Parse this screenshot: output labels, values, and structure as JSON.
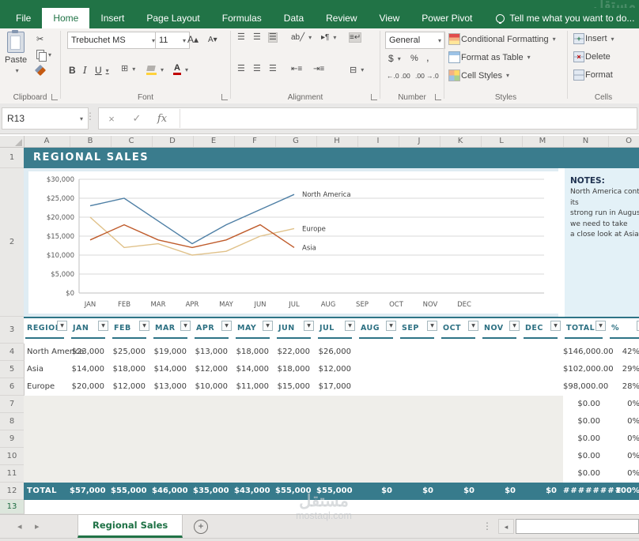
{
  "app": {
    "tell_me": "Tell me what you want to do...",
    "name_box": "R13",
    "formula_fx": "fx",
    "formula_value": ""
  },
  "ribbon": {
    "tabs": [
      "File",
      "Home",
      "Insert",
      "Page Layout",
      "Formulas",
      "Data",
      "Review",
      "View",
      "Power Pivot"
    ],
    "active_tab": "Home",
    "paste_label": "Paste",
    "font_name": "Trebuchet MS",
    "font_size": "11",
    "number_format": "General",
    "styles_buttons": [
      "Conditional Formatting",
      "Format as Table",
      "Cell Styles"
    ],
    "cells_buttons": [
      "Insert",
      "Delete",
      "Format"
    ],
    "group_labels": [
      "Clipboard",
      "Font",
      "Alignment",
      "Number",
      "Styles",
      "Cells"
    ]
  },
  "grid": {
    "columns": [
      "A",
      "B",
      "C",
      "D",
      "E",
      "F",
      "G",
      "H",
      "I",
      "J",
      "K",
      "L",
      "M",
      "N",
      "O"
    ],
    "rows": [
      "1",
      "2",
      "3",
      "4",
      "5",
      "6",
      "7",
      "8",
      "9",
      "10",
      "11",
      "12",
      "13"
    ],
    "selected_row": "13"
  },
  "sheet": {
    "title": "REGIONAL SALES",
    "notes_heading": "NOTES:",
    "notes_lines": [
      "North America continues",
      "its",
      "strong run in August, but",
      "we need to take",
      "a close look at Asia."
    ]
  },
  "chart_data": {
    "type": "line",
    "x": [
      "JAN",
      "FEB",
      "MAR",
      "APR",
      "MAY",
      "JUN",
      "JUL",
      "AUG",
      "SEP",
      "OCT",
      "NOV",
      "DEC"
    ],
    "series": [
      {
        "name": "North America",
        "color": "#4E7FA5",
        "values": [
          23000,
          25000,
          19000,
          13000,
          18000,
          22000,
          26000
        ]
      },
      {
        "name": "Europe",
        "color": "#E0C189",
        "values": [
          20000,
          12000,
          13000,
          10000,
          11000,
          15000,
          17000
        ]
      },
      {
        "name": "Asia",
        "color": "#BF5B2B",
        "values": [
          14000,
          18000,
          14000,
          12000,
          14000,
          18000,
          12000
        ]
      }
    ],
    "ylim": [
      0,
      30000
    ],
    "ytick_step": 5000,
    "ytick_labels": [
      "$0",
      "$5,000",
      "$10,000",
      "$15,000",
      "$20,000",
      "$25,000",
      "$30,000"
    ],
    "grid": true,
    "legend_position": "line-end"
  },
  "table": {
    "headers": [
      "REGION",
      "JAN",
      "FEB",
      "MAR",
      "APR",
      "MAY",
      "JUN",
      "JUL",
      "AUG",
      "SEP",
      "OCT",
      "NOV",
      "DEC",
      "TOTAL",
      "%"
    ],
    "rows": [
      {
        "region": "North America",
        "months": [
          "$23,000",
          "$25,000",
          "$19,000",
          "$13,000",
          "$18,000",
          "$22,000",
          "$26,000",
          "",
          "",
          "",
          "",
          ""
        ],
        "total": "$146,000.00",
        "pct": "42%"
      },
      {
        "region": "Asia",
        "months": [
          "$14,000",
          "$18,000",
          "$14,000",
          "$12,000",
          "$14,000",
          "$18,000",
          "$12,000",
          "",
          "",
          "",
          "",
          ""
        ],
        "total": "$102,000.00",
        "pct": "29%"
      },
      {
        "region": "Europe",
        "months": [
          "$20,000",
          "$12,000",
          "$13,000",
          "$10,000",
          "$11,000",
          "$15,000",
          "$17,000",
          "",
          "",
          "",
          "",
          ""
        ],
        "total": "$98,000.00",
        "pct": "28%"
      },
      {
        "region": "",
        "months": [
          "",
          "",
          "",
          "",
          "",
          "",
          "",
          "",
          "",
          "",
          "",
          ""
        ],
        "total": "$0.00",
        "pct": "0%"
      },
      {
        "region": "",
        "months": [
          "",
          "",
          "",
          "",
          "",
          "",
          "",
          "",
          "",
          "",
          "",
          ""
        ],
        "total": "$0.00",
        "pct": "0%"
      },
      {
        "region": "",
        "months": [
          "",
          "",
          "",
          "",
          "",
          "",
          "",
          "",
          "",
          "",
          "",
          ""
        ],
        "total": "$0.00",
        "pct": "0%"
      },
      {
        "region": "",
        "months": [
          "",
          "",
          "",
          "",
          "",
          "",
          "",
          "",
          "",
          "",
          "",
          ""
        ],
        "total": "$0.00",
        "pct": "0%"
      },
      {
        "region": "",
        "months": [
          "",
          "",
          "",
          "",
          "",
          "",
          "",
          "",
          "",
          "",
          "",
          ""
        ],
        "total": "$0.00",
        "pct": "0%"
      }
    ],
    "total_row": {
      "label": "TOTAL",
      "months": [
        "$57,000",
        "$55,000",
        "$46,000",
        "$35,000",
        "$43,000",
        "$55,000",
        "$55,000",
        "$0",
        "$0",
        "$0",
        "$0",
        "$0"
      ],
      "total": "########",
      "pct": "100%"
    }
  },
  "sheet_tabs": {
    "active": "Regional Sales"
  },
  "watermark": {
    "line1": "مستقل",
    "line2": "mostaql.com"
  }
}
